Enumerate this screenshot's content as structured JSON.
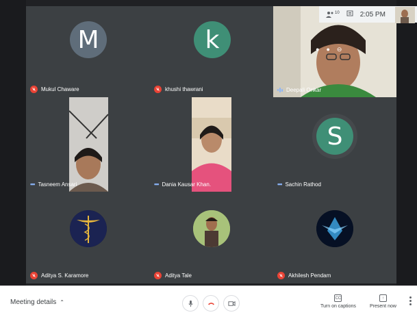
{
  "topbar": {
    "participants_count": "10",
    "time": "2:05 PM"
  },
  "participants": [
    {
      "name": "Mukul Chaware",
      "initial": "M",
      "avatar_color": "#5f6d7a",
      "status": "muted"
    },
    {
      "name": "khushi thawrani",
      "initial": "k",
      "avatar_color": "#3f8f76",
      "status": "muted"
    },
    {
      "name": "Deepali Onkar",
      "initial": "",
      "status": "speaking"
    },
    {
      "name": "Tasneem Ansari",
      "initial": "",
      "status": "dots"
    },
    {
      "name": "Dania Kausar Khan.",
      "initial": "",
      "status": "dots"
    },
    {
      "name": "Sachin Rathod",
      "initial": "S",
      "avatar_color": "#3f8f76",
      "status": "dots"
    },
    {
      "name": "Aditya S. Karamore",
      "initial": "",
      "status": "muted"
    },
    {
      "name": "Aditya Tale",
      "initial": "",
      "status": "muted"
    },
    {
      "name": "Akhilesh Pendam",
      "initial": "",
      "status": "muted"
    }
  ],
  "bottombar": {
    "meeting_details": "Meeting details",
    "captions_label": "Turn on captions",
    "present_label": "Present now",
    "captions_icon": "CC"
  },
  "colors": {
    "accent": "#8ab4f8",
    "danger": "#ea4335",
    "tile": "#3c4043",
    "background": "#202124"
  }
}
